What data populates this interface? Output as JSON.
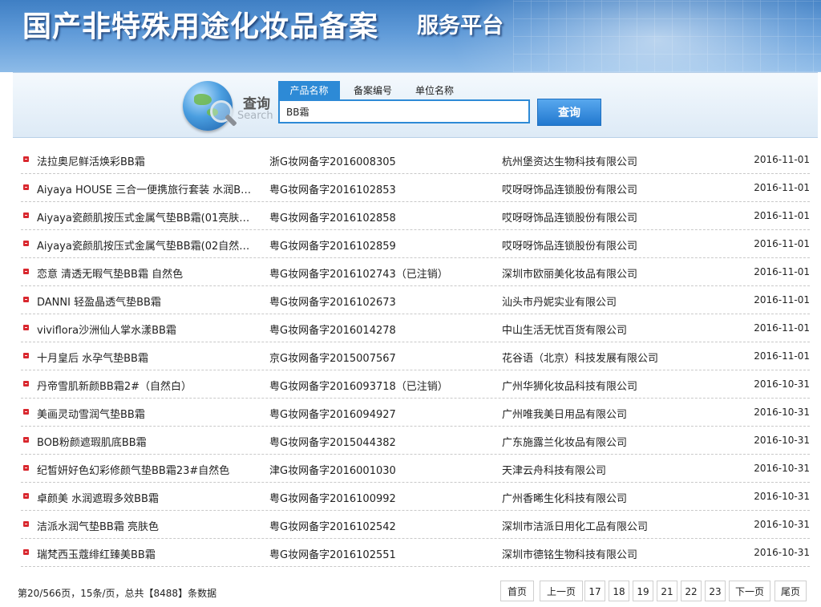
{
  "header": {
    "title": "国产非特殊用途化妆品备案",
    "subtitle": "服务平台"
  },
  "search": {
    "label_cn": "查询",
    "label_en": "Search",
    "tabs": [
      "产品名称",
      "备案编号",
      "单位名称"
    ],
    "active_tab": "产品名称",
    "input_value": "BB霜",
    "button_label": "查询"
  },
  "results": [
    {
      "name": "法拉奥尼鲜活焕彩BB霜",
      "code": "浙G妆网备字2016008305",
      "company": "杭州堡资达生物科技有限公司",
      "date": "2016-11-01"
    },
    {
      "name": "Aiyaya HOUSE 三合一便携旅行套装 水润B…",
      "code": "粤G妆网备字2016102853",
      "company": "哎呀呀饰品连锁股份有限公司",
      "date": "2016-11-01"
    },
    {
      "name": "Aiyaya瓷颜肌按压式金属气垫BB霜(01亮肤…",
      "code": "粤G妆网备字2016102858",
      "company": "哎呀呀饰品连锁股份有限公司",
      "date": "2016-11-01"
    },
    {
      "name": "Aiyaya瓷颜肌按压式金属气垫BB霜(02自然…",
      "code": "粤G妆网备字2016102859",
      "company": "哎呀呀饰品连锁股份有限公司",
      "date": "2016-11-01"
    },
    {
      "name": "恋意 清透无暇气垫BB霜 自然色",
      "code": "粤G妆网备字2016102743（已注销）",
      "company": "深圳市欧丽美化妆品有限公司",
      "date": "2016-11-01"
    },
    {
      "name": "DANNI 轻盈晶透气垫BB霜",
      "code": "粤G妆网备字2016102673",
      "company": "汕头市丹妮实业有限公司",
      "date": "2016-11-01"
    },
    {
      "name": "viviflora沙洲仙人掌水漾BB霜",
      "code": "粤G妆网备字2016014278",
      "company": "中山生活无忧百货有限公司",
      "date": "2016-11-01"
    },
    {
      "name": "十月皇后 水孕气垫BB霜",
      "code": "京G妆网备字2015007567",
      "company": "花谷语（北京）科技发展有限公司",
      "date": "2016-11-01"
    },
    {
      "name": "丹帝雪肌新颜BB霜2#（自然白）",
      "code": "粤G妆网备字2016093718（已注销）",
      "company": "广州华狮化妆品科技有限公司",
      "date": "2016-10-31"
    },
    {
      "name": "美画灵动雪润气垫BB霜",
      "code": "粤G妆网备字2016094927",
      "company": "广州唯我美日用品有限公司",
      "date": "2016-10-31"
    },
    {
      "name": "BOB粉颜遮瑕肌底BB霜",
      "code": "粤G妆网备字2015044382",
      "company": "广东施露兰化妆品有限公司",
      "date": "2016-10-31"
    },
    {
      "name": "纪皙妍好色幻彩修颜气垫BB霜23#自然色",
      "code": "津G妆网备字2016001030",
      "company": "天津云舟科技有限公司",
      "date": "2016-10-31"
    },
    {
      "name": "卓颜美 水润遮瑕多效BB霜",
      "code": "粤G妆网备字2016100992",
      "company": "广州香晞生化科技有限公司",
      "date": "2016-10-31"
    },
    {
      "name": "洁派水润气垫BB霜 亮肤色",
      "code": "粤G妆网备字2016102542",
      "company": "深圳市洁派日用化工品有限公司",
      "date": "2016-10-31"
    },
    {
      "name": "瑞梵西玉蔻绯红臻美BB霜",
      "code": "粤G妆网备字2016102551",
      "company": "深圳市德铭生物科技有限公司",
      "date": "2016-10-31"
    }
  ],
  "pagination": {
    "info": "第20/566页，15条/页，总共【8488】条数据",
    "first": "首页",
    "prev": "上一页",
    "pages": [
      "17",
      "18",
      "19",
      "21",
      "22",
      "23"
    ],
    "next": "下一页",
    "last": "尾页"
  }
}
